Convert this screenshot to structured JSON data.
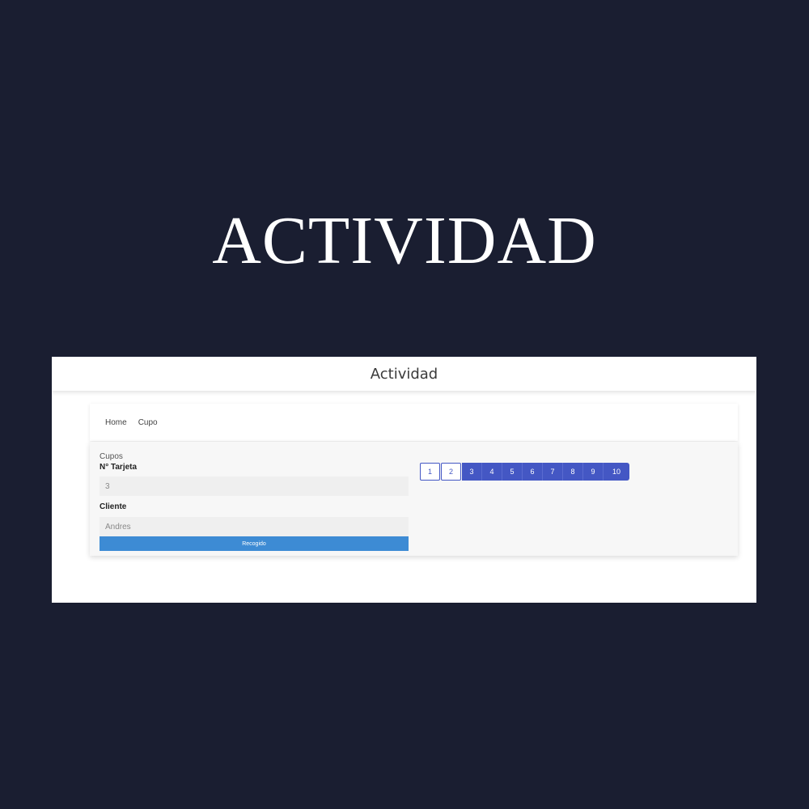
{
  "hero": {
    "title": "ACTIVIDAD"
  },
  "app": {
    "header_title": "Actividad",
    "nav": [
      "Home",
      "Cupo"
    ],
    "form": {
      "section_label": "Cupos",
      "card_label": "N° Tarjeta",
      "card_value": "3",
      "client_label": "Cliente",
      "client_value": "Andres",
      "submit_label": "Recogido"
    },
    "pagination": {
      "pages": [
        "1",
        "2",
        "3",
        "4",
        "5",
        "6",
        "7",
        "8",
        "9",
        "10"
      ],
      "outlined_pages": [
        "1",
        "2"
      ],
      "active_color": "#4457c4"
    }
  }
}
